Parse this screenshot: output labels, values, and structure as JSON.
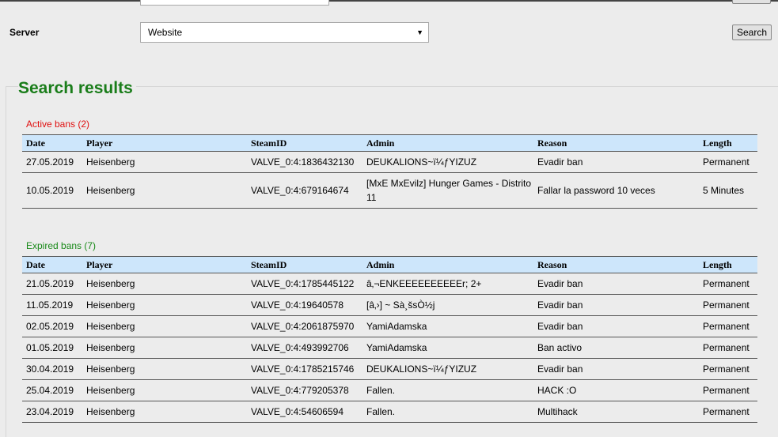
{
  "search_form": {
    "server_label": "Server",
    "server_selected": "Website",
    "search_button": "Search"
  },
  "results": {
    "title": "Search results",
    "columns": [
      "Date",
      "Player",
      "SteamID",
      "Admin",
      "Reason",
      "Length"
    ],
    "active": {
      "title": "Active bans (2)",
      "rows": [
        [
          "27.05.2019",
          "Heisenberg",
          "VALVE_0:4:1836432130",
          "DEUKALIONS~ï¼ƒYIZUZ",
          "Evadir ban",
          "Permanent"
        ],
        [
          "10.05.2019",
          "Heisenberg",
          "VALVE_0:4:679164674",
          "[MxE MxEvilz] Hunger Games - Distrito 11",
          "Fallar la password 10 veces",
          "5 Minutes"
        ]
      ]
    },
    "expired": {
      "title": "Expired bans (7)",
      "rows": [
        [
          "21.05.2019",
          "Heisenberg",
          "VALVE_0:4:1785445122",
          "â‚¬ENKEEEEEEEEEEr; 2+",
          "Evadir ban",
          "Permanent"
        ],
        [
          "11.05.2019",
          "Heisenberg",
          "VALVE_0:4:19640578",
          "[â‚›] ~ Sà¸šsÒ½j",
          "Evadir ban",
          "Permanent"
        ],
        [
          "02.05.2019",
          "Heisenberg",
          "VALVE_0:4:2061875970",
          "YamiAdamska",
          "Evadir ban",
          "Permanent"
        ],
        [
          "01.05.2019",
          "Heisenberg",
          "VALVE_0:4:493992706",
          "YamiAdamska",
          "Ban activo",
          "Permanent"
        ],
        [
          "30.04.2019",
          "Heisenberg",
          "VALVE_0:4:1785215746",
          "DEUKALIONS~ï¼ƒYIZUZ",
          "Evadir ban",
          "Permanent"
        ],
        [
          "25.04.2019",
          "Heisenberg",
          "VALVE_0:4:779205378",
          "Fallen.",
          "HACK :O",
          "Permanent"
        ],
        [
          "23.04.2019",
          "Heisenberg",
          "VALVE_0:4:54606594",
          "Fallen.",
          "Multihack",
          "Permanent"
        ]
      ]
    }
  },
  "colors": {
    "title_green": "#1a7d1a",
    "active_red": "#e01010",
    "expired_green": "#1a8a1a",
    "header_blue": "#cde6fb"
  }
}
